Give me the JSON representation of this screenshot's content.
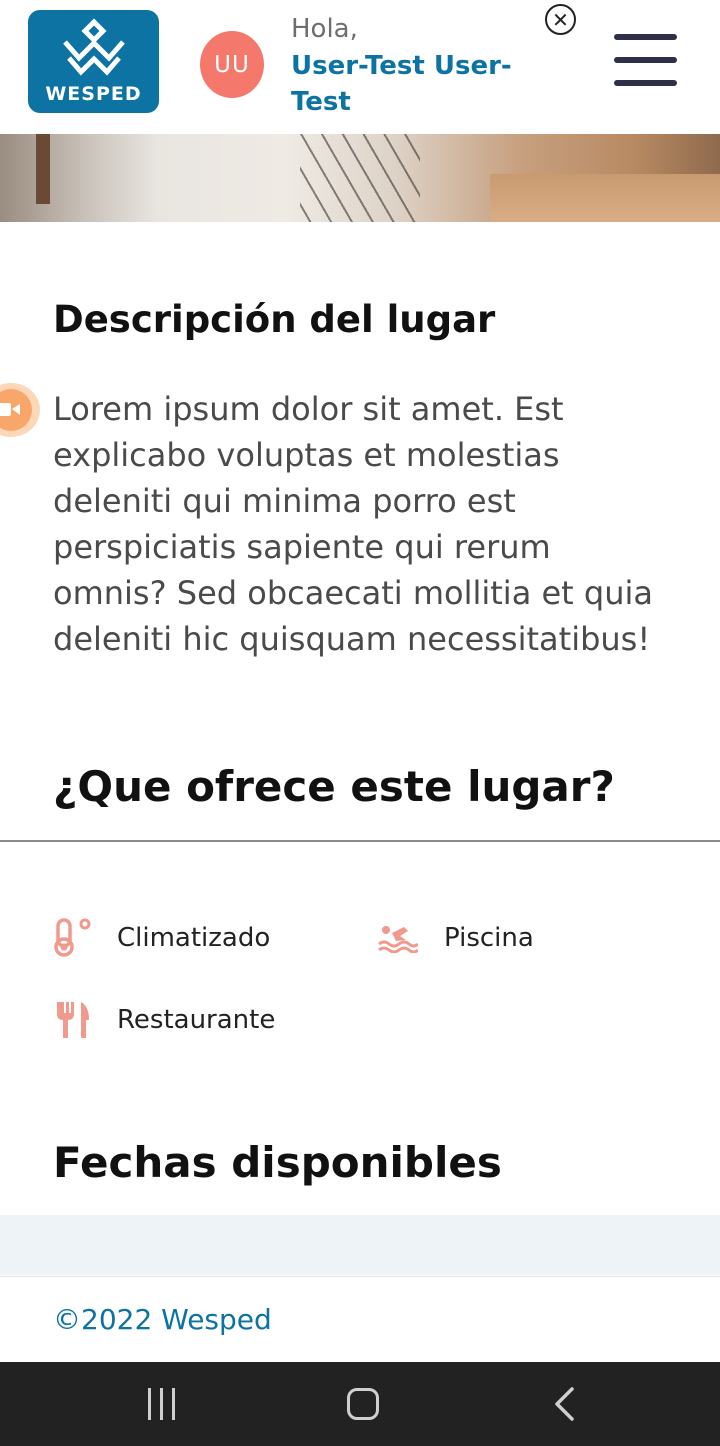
{
  "header": {
    "logo_text": "WESPED",
    "avatar_initials": "UU",
    "greeting": "Hola,",
    "username": "User-Test User-Test"
  },
  "description": {
    "title": "Descripción del lugar",
    "text": "Lorem ipsum dolor sit amet. Est explicabo voluptas et molestias deleniti qui minima porro est perspiciatis sapiente qui rerum omnis? Sed obcaecati mollitia et quia deleniti hic quisquam necessitatibus!"
  },
  "offers": {
    "title": "¿Que ofrece este lugar?",
    "items": [
      {
        "label": "Climatizado",
        "icon": "thermometer-icon"
      },
      {
        "label": "Piscina",
        "icon": "swimming-icon"
      },
      {
        "label": "Restaurante",
        "icon": "utensils-icon"
      }
    ]
  },
  "dates": {
    "title": "Fechas disponibles"
  },
  "footer": {
    "text": "©2022 Wesped"
  },
  "colors": {
    "brand": "#0c73a3",
    "avatar": "#f4786b",
    "icon_accent": "#f2998e"
  }
}
